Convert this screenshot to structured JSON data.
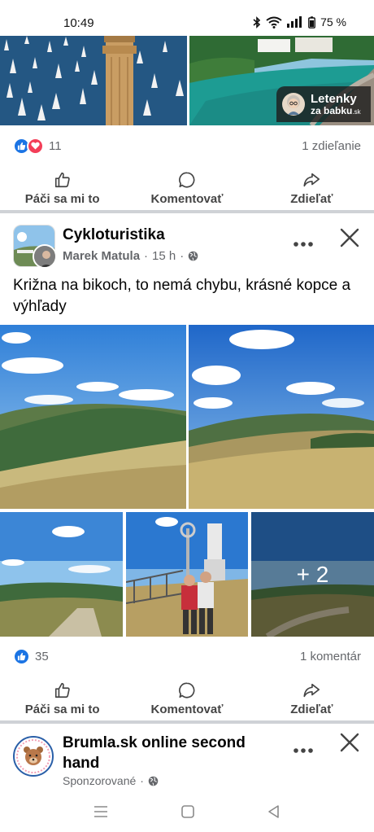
{
  "status_bar": {
    "time": "10:49",
    "battery": "75 %"
  },
  "ad_badge": {
    "title": "Letenky",
    "subtitle": "za babku",
    "suffix": ".sk"
  },
  "post1": {
    "reaction_count": "11",
    "shares": "1 zdieľanie",
    "actions": {
      "like": "Páči sa mi to",
      "comment": "Komentovať",
      "share": "Zdieľať"
    }
  },
  "post2": {
    "group": "Cykloturistika",
    "author": "Marek Matula",
    "time": "15 h",
    "separator": "·",
    "text": "Križna na bikoch, to nemá chybu, krásné kopce a výhľady",
    "more_photos": "+ 2",
    "reaction_count": "35",
    "comments": "1 komentár",
    "actions": {
      "like": "Páči sa mi to",
      "comment": "Komentovať",
      "share": "Zdieľať"
    }
  },
  "post3": {
    "title": "Brumla.sk online second hand",
    "sponsored": "Sponzorované",
    "separator": "·"
  },
  "icons": {
    "like": "thumbs-up-icon",
    "love": "heart-icon",
    "comment": "speech-bubble-icon",
    "share": "share-arrow-icon",
    "globe": "globe-icon",
    "more": "more-dots-icon",
    "close": "close-icon"
  },
  "colors": {
    "like_blue": "#1b74e4",
    "love_red": "#f33e58",
    "meta_gray": "#65676b",
    "separator": "#cfd2d6"
  }
}
